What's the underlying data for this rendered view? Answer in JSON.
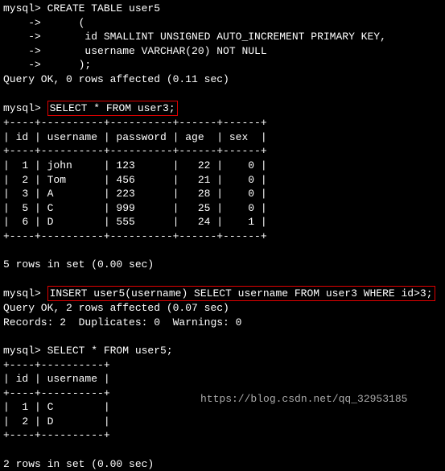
{
  "prompt": "mysql>",
  "cont": "    ->",
  "cmd1_a": " CREATE TABLE user5",
  "cmd1_b": "      (",
  "cmd1_c": "       id SMALLINT UNSIGNED AUTO_INCREMENT PRIMARY KEY,",
  "cmd1_d": "       username VARCHAR(20) NOT NULL",
  "cmd1_e": "      );",
  "res1": "Query OK, 0 rows affected (0.11 sec)",
  "cmd2": "SELECT * FROM user3;",
  "table1": {
    "border_top": "+----+----------+----------+------+------+",
    "header": "| id | username | password | age  | sex  |",
    "border_mid": "+----+----------+----------+------+------+",
    "rows": [
      "|  1 | john     | 123      |   22 |    0 |",
      "|  2 | Tom      | 456      |   21 |    0 |",
      "|  3 | A        | 223      |   28 |    0 |",
      "|  5 | C        | 999      |   25 |    0 |",
      "|  6 | D        | 555      |   24 |    1 |"
    ],
    "border_bot": "+----+----------+----------+------+------+"
  },
  "res2": "5 rows in set (0.00 sec)",
  "cmd3": "INSERT user5(username) SELECT username FROM user3 WHERE id>3;",
  "res3a": "Query OK, 2 rows affected (0.07 sec)",
  "res3b": "Records: 2  Duplicates: 0  Warnings: 0",
  "cmd4": " SELECT * FROM user5;",
  "table2": {
    "border_top": "+----+----------+",
    "header": "| id | username |",
    "border_mid": "+----+----------+",
    "rows": [
      "|  1 | C        |",
      "|  2 | D        |"
    ],
    "border_bot": "+----+----------+"
  },
  "res4": "2 rows in set (0.00 sec)",
  "watermark": "https://blog.csdn.net/qq_32953185",
  "chart_data": {
    "type": "table",
    "tables": [
      {
        "name": "user3",
        "columns": [
          "id",
          "username",
          "password",
          "age",
          "sex"
        ],
        "rows": [
          [
            1,
            "john",
            "123",
            22,
            0
          ],
          [
            2,
            "Tom",
            "456",
            21,
            0
          ],
          [
            3,
            "A",
            "223",
            28,
            0
          ],
          [
            5,
            "C",
            "999",
            25,
            0
          ],
          [
            6,
            "D",
            "555",
            24,
            1
          ]
        ]
      },
      {
        "name": "user5",
        "columns": [
          "id",
          "username"
        ],
        "rows": [
          [
            1,
            "C"
          ],
          [
            2,
            "D"
          ]
        ]
      }
    ]
  }
}
